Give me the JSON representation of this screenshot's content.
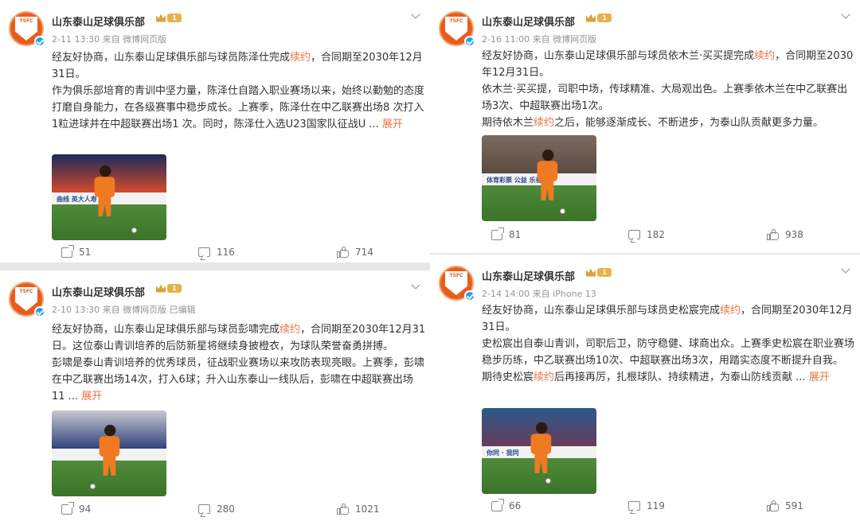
{
  "posts": [
    {
      "account": "山东泰山足球俱乐部",
      "vip_level": "1",
      "meta": "2-11 13:30  来自 微博网页版",
      "body": [
        [
          {
            "t": "经友好协商，山东泰山足球俱乐部与球员陈泽仕完成"
          },
          {
            "t": "续约",
            "h": true
          },
          {
            "t": "，合同期至2030年12月31日。"
          }
        ],
        [
          {
            "t": "作为俱乐部培育的青训中坚力量，陈泽仕自踏入职业赛场以来，始终以勤勉的态度打磨自身能力，在各级赛事中稳步成长。上赛季，陈泽仕在中乙联赛出场8 次打入1粒进球并在中超联赛出场1 次。同时，陈泽仕入选U23国家队征战U ..."
          },
          {
            "t": " 展开",
            "m": true
          }
        ]
      ],
      "photo": {
        "board_text": "曲线 英大人寿 联"
      },
      "stats": {
        "reposts": "51",
        "comments": "116",
        "likes": "714"
      }
    },
    {
      "account": "山东泰山足球俱乐部",
      "vip_level": "1",
      "meta": "2-16 11:00  来自 微博网页版",
      "body": [
        [
          {
            "t": "经友好协商，山东泰山足球俱乐部与球员依木兰·买买提完成"
          },
          {
            "t": "续约",
            "h": true
          },
          {
            "t": "，合同期至2030年12月31日。"
          }
        ],
        [
          {
            "t": "依木兰·买买提，司职中场，传球精准、大局观出色。上赛季依木兰在中乙联赛出场3次、中超联赛出场1次。"
          }
        ],
        [
          {
            "t": "期待依木兰"
          },
          {
            "t": "续约",
            "h": true
          },
          {
            "t": "之后，能够逐渐成长、不断进步，为泰山队贡献更多力量。"
          }
        ]
      ],
      "photo": {
        "board_text": "体育彩票  公益  乐善人"
      },
      "stats": {
        "reposts": "81",
        "comments": "182",
        "likes": "938"
      }
    },
    {
      "account": "山东泰山足球俱乐部",
      "vip_level": "1",
      "meta": "2-10 13:30  来自 微博网页版  已编辑",
      "body": [
        [
          {
            "t": "经友好协商，山东泰山足球俱乐部与球员彭啸完成"
          },
          {
            "t": "续约",
            "h": true
          },
          {
            "t": "，合同期至2030年12月31日。这位泰山青训培养的后防新星将继续身披橙衣，为球队荣誉奋勇拼搏。"
          }
        ],
        [
          {
            "t": "彭啸是泰山青训培养的优秀球员，征战职业赛场以来攻防表现亮眼。上赛季，彭啸在中乙联赛出场14次，打入6球；升入山东泰山一线队后，彭啸在中超联赛出场11 ..."
          },
          {
            "t": " 展开",
            "m": true
          }
        ]
      ],
      "photo": {
        "board_text": ""
      },
      "stats": {
        "reposts": "94",
        "comments": "280",
        "likes": "1021"
      }
    },
    {
      "account": "山东泰山足球俱乐部",
      "vip_level": "1",
      "meta": "2-14 14:00  来自 iPhone 13",
      "body": [
        [
          {
            "t": "经友好协商，山东泰山足球俱乐部与球员史松宸完成"
          },
          {
            "t": "续约",
            "h": true
          },
          {
            "t": "，合同期至2030年12月31日。"
          }
        ],
        [
          {
            "t": "史松宸出自泰山青训，司职后卫，防守稳健、球商出众。上赛季史松宸在职业赛场稳步历练，中乙联赛出场10次、中超联赛出场3次，用踏实态度不断提升自我。"
          }
        ],
        [
          {
            "t": "期待史松宸"
          },
          {
            "t": "续约",
            "h": true
          },
          {
            "t": "后再接再厉，扎根球队、持续精进，为泰山防线贡献 ..."
          },
          {
            "t": " 展开",
            "m": true
          }
        ]
      ],
      "photo": {
        "board_text": "你同 · 我同"
      },
      "stats": {
        "reposts": "66",
        "comments": "119",
        "likes": "591"
      }
    }
  ],
  "icons": {
    "avatar": "club-crest-icon",
    "verified": "verified-icon",
    "vip": "crown-icon",
    "menu": "chevron-down-icon",
    "repost": "repost-icon",
    "comment": "comment-icon",
    "like": "like-icon"
  },
  "colors": {
    "accent": "#eb7340",
    "verified": "#1da1f2",
    "vip": "#e7b24c",
    "club": "#e85d1e"
  }
}
